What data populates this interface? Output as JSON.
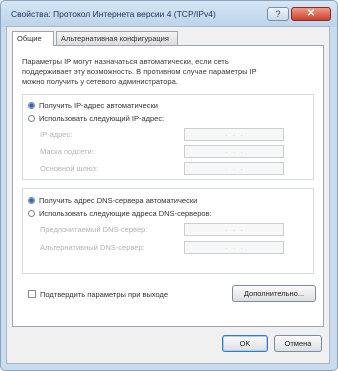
{
  "window": {
    "title": "Свойства: Протокол Интернета версии 4 (TCP/IPv4)",
    "help_glyph": "?",
    "close_glyph": "✕"
  },
  "tabs": [
    {
      "label": "Общие",
      "active": true
    },
    {
      "label": "Альтернативная конфигурация",
      "active": false
    }
  ],
  "intro_text": "Параметры IP могут назначаться автоматически, если сеть поддерживает эту возможность. В противном случае параметры IP можно получить у сетевого администратора.",
  "ip_section": {
    "auto_label": "Получить IP-адрес автоматически",
    "manual_label": "Использовать следующий IP-адрес:",
    "selected": "auto",
    "fields": [
      {
        "label": "IP-адрес:",
        "value": ".   .   ."
      },
      {
        "label": "Маска подсети:",
        "value": ".   .   ."
      },
      {
        "label": "Основной шлюз:",
        "value": ".   .   ."
      }
    ]
  },
  "dns_section": {
    "auto_label": "Получить адрес DNS-сервера автоматически",
    "manual_label": "Использовать следующие адреса DNS-серверов:",
    "selected": "auto",
    "fields": [
      {
        "label": "Предпочитаемый DNS-сервер:",
        "value": ".   .   ."
      },
      {
        "label": "Альтернативный DNS-сервер:",
        "value": ".   .   ."
      }
    ]
  },
  "validate_checkbox": {
    "label": "Подтвердить параметры при выходе",
    "checked": false
  },
  "buttons": {
    "advanced": "Дополнительно...",
    "ok": "OK",
    "cancel": "Отмена"
  }
}
